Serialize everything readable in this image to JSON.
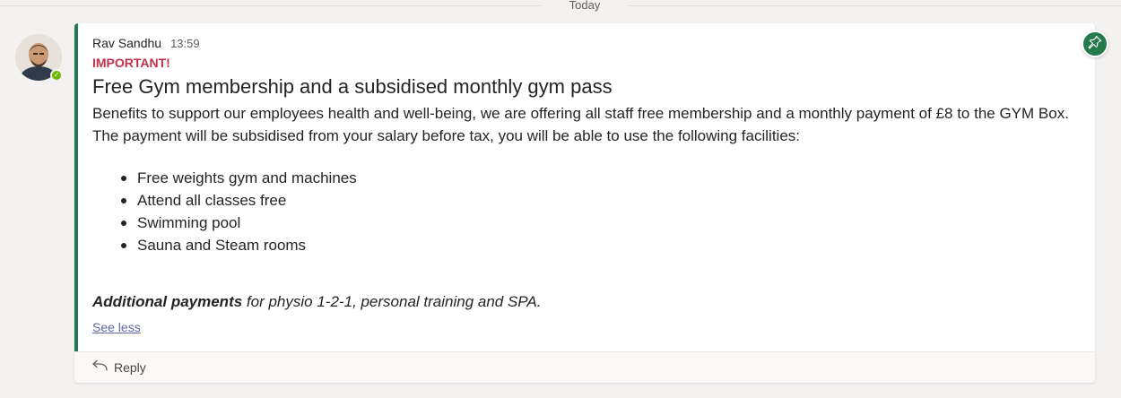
{
  "divider": {
    "label": "Today"
  },
  "message": {
    "author": "Rav Sandhu",
    "time": "13:59",
    "importance": "IMPORTANT!",
    "subject": "Free Gym membership and a subsidised monthly gym pass",
    "paragraph": "Benefits to support our employees health and well-being, we are offering all staff free membership and a monthly payment of £8 to the GYM Box. The payment will be subsidised from your salary before tax, you will be able to use the following facilities:",
    "facilities": [
      "Free weights gym and machines",
      "Attend all classes free",
      "Swimming pool",
      "Sauna and Steam rooms"
    ],
    "additional_bold": "Additional payments",
    "additional_rest": " for physio 1-2-1, personal training and SPA.",
    "see_less": "See less"
  },
  "reply": {
    "label": "Reply"
  },
  "colors": {
    "accent": "#237b4b",
    "important": "#c4314b",
    "link": "#6264a7",
    "presence": "#6bb700"
  },
  "icons": {
    "pin": "pin-icon",
    "reply": "reply-arrow-icon",
    "presence": "presence-available-icon"
  }
}
